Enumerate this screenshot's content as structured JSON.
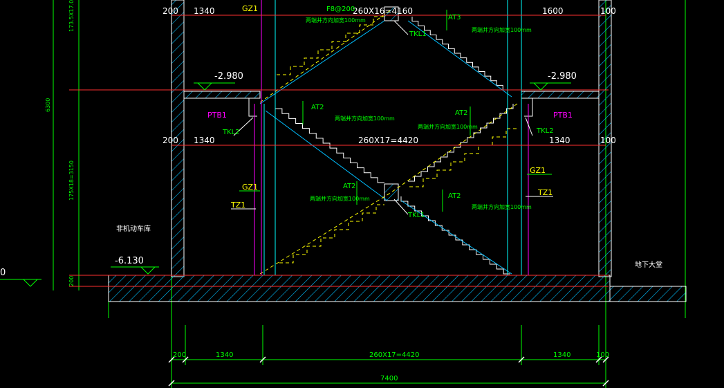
{
  "dimensions": {
    "top_left": "200",
    "top_1340": "1340",
    "top_run": "260X16=4160",
    "top_1600": "1600",
    "top_right": "100",
    "mid_left": "200",
    "mid_1340": "1340",
    "mid_run": "260X17=4420",
    "mid_1340_right": "1340",
    "mid_right": "100",
    "bot_left": "200",
    "bot_1340": "1340",
    "bot_run": "260X17=4420",
    "bot_1340_right": "1340",
    "bot_right": "100",
    "total": "7400",
    "vert_top": "173.5X17.0",
    "vert_6300": "6300",
    "vert_mid": "175X18=3150",
    "vert_bottom": "200"
  },
  "elevations": {
    "landing_left": "-2.980",
    "landing_right": "-2.980",
    "ground_left": "-6.130",
    "far_left": "0"
  },
  "labels": {
    "gz1_top": "GZ1",
    "rebar": "F8@200",
    "rebar_note": "两端并方向加宽100mm",
    "at3": "AT3",
    "tkl1_top": "TKL1",
    "at2_a": "AT2",
    "at2_b": "AT2",
    "note_a": "两端并方向加宽100mm",
    "note_b": "两端并方向加宽100mm",
    "ptb1_left": "PTB1",
    "ptb1_right": "PTB1",
    "tkl2_left": "TKL2",
    "tkl2_right": "TKL2",
    "gz1_left": "GZ1",
    "tz1_left": "TZ1",
    "gz1_right": "GZ1",
    "tz1_right": "TZ1",
    "at2_c": "AT2",
    "at2_d": "AT2",
    "note_c": "两端并方向加宽100mm",
    "note_d": "两端并方向加宽100mm",
    "tkl1_bot": "TKL1",
    "room_left": "非机动车库",
    "room_right": "地下大堂"
  },
  "colors": {
    "background": "#000000",
    "wall": "#00bfff",
    "structure": "#ffffff",
    "dimension": "#ff3030",
    "stair_top": "#ffff00",
    "green": "#00ff00",
    "magenta": "#ff00ff",
    "cyan": "#00ffff"
  }
}
